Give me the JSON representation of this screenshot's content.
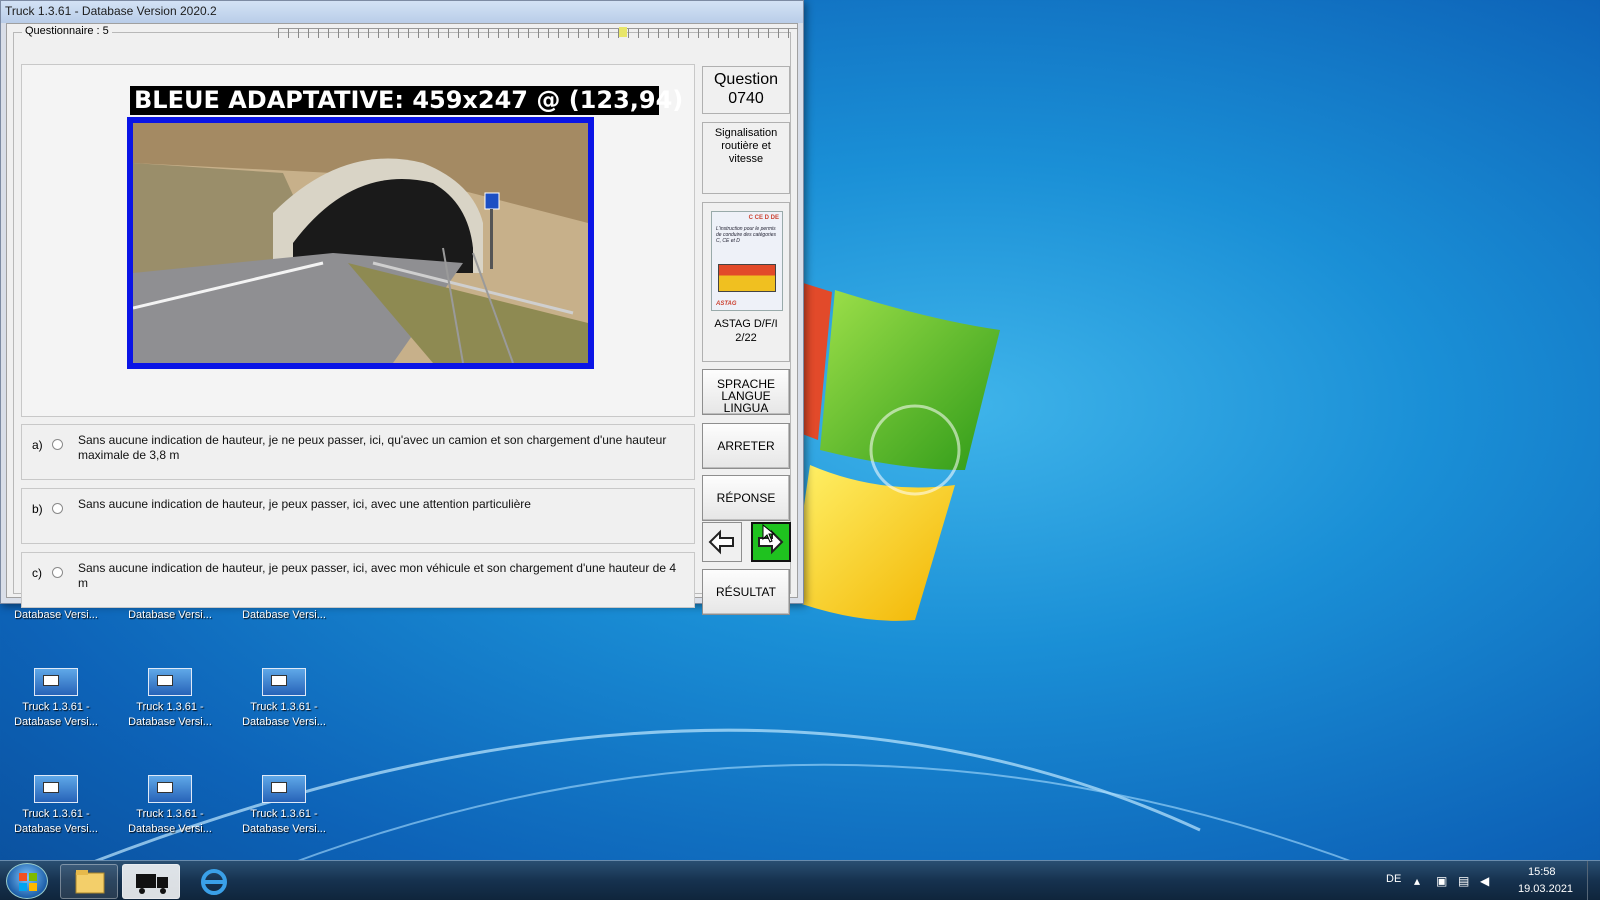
{
  "window": {
    "title": "Truck 1.3.61 - Database Version 2020.2",
    "group_label": "Questionnaire : 5"
  },
  "overlay_label": "BLEUE ADAPTATIVE: 459x247 @ (123,94)",
  "question": {
    "label": "Question",
    "number": "0740",
    "category_line1": "Signalisation",
    "category_line2": "routière et vitesse"
  },
  "book": {
    "label_line1": "ASTAG D/F/I",
    "label_line2": "2/22",
    "cover_badges": "C CE D DE",
    "cover_text": "L'instruction pour le permis de conduire des catégories C, CE et D",
    "cover_brand": "ASTAG"
  },
  "answers": [
    {
      "letter": "a)",
      "text": "Sans aucune indication de hauteur, je ne peux passer, ici, qu'avec un camion et son chargement d'une hauteur maximale de 3,8 m"
    },
    {
      "letter": "b)",
      "text": "Sans aucune indication de hauteur, je peux passer, ici, avec une attention particulière"
    },
    {
      "letter": "c)",
      "text": "Sans aucune indication de hauteur, je peux passer, ici, avec mon véhicule et son chargement d'une hauteur de 4 m"
    }
  ],
  "buttons": {
    "language_line1": "SPRACHE",
    "language_line2": "LANGUE",
    "language_line3": "LINGUA",
    "stop": "ARRETER",
    "answer": "RÉPONSE",
    "result": "RÉSULTAT"
  },
  "desktop": {
    "partial_icon_label": "Database Versi...",
    "icon_label_line1": "Truck 1.3.61 -",
    "icon_label_line2": "Database Versi..."
  },
  "taskbar": {
    "language": "DE",
    "time": "15:58",
    "date": "19.03.2021"
  },
  "colors": {
    "image_frame": "#0a14e6",
    "next_button": "#1fc21f",
    "desktop_blue": "#1a8fd6"
  }
}
